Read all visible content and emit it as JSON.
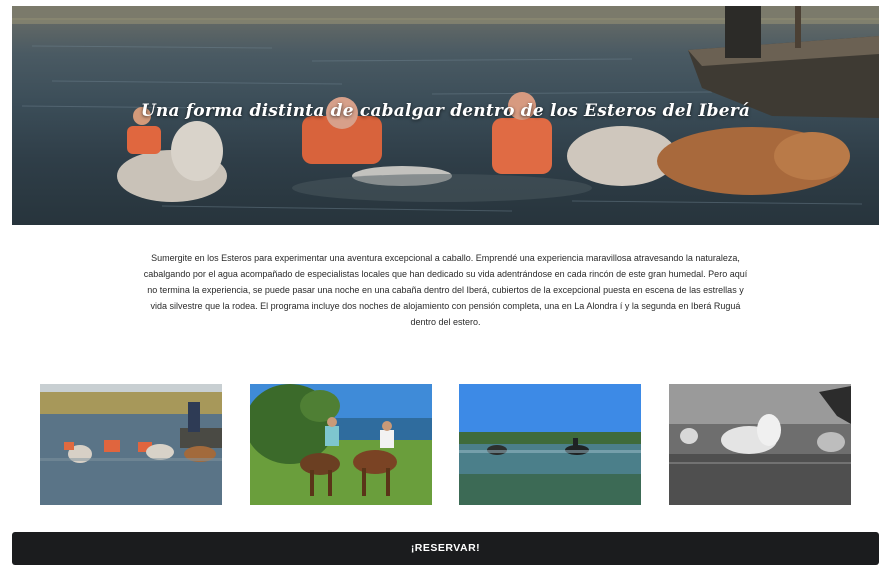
{
  "hero": {
    "title": "Una forma distinta de cabalgar dentro de los Esteros del Iberá"
  },
  "description": {
    "text": "Sumergite en los Esteros para experimentar una aventura excepcional a caballo. Emprendé una experiencia maravillosa atravesando la naturaleza, cabalgando por el agua acompañado de especialistas locales que han dedicado su vida adentrándose en cada rincón de este gran humedal. Pero aquí no termina la experiencia, se puede pasar una noche en una cabaña dentro del Iberá, cubiertos de la excepcional puesta en escena de las estrellas y vida silvestre que la rodea. El programa incluye dos noches de alojamiento con pensión completa, una en La Alondra í y la segunda en Iberá Ruguá dentro del estero."
  },
  "gallery": {
    "items": [
      {
        "icon": "photo-horses-swimming"
      },
      {
        "icon": "photo-riders-lakeshore"
      },
      {
        "icon": "photo-riders-wetland"
      },
      {
        "icon": "photo-horse-swimming-bw"
      }
    ]
  },
  "cta": {
    "label": "¡RESERVAR!"
  }
}
